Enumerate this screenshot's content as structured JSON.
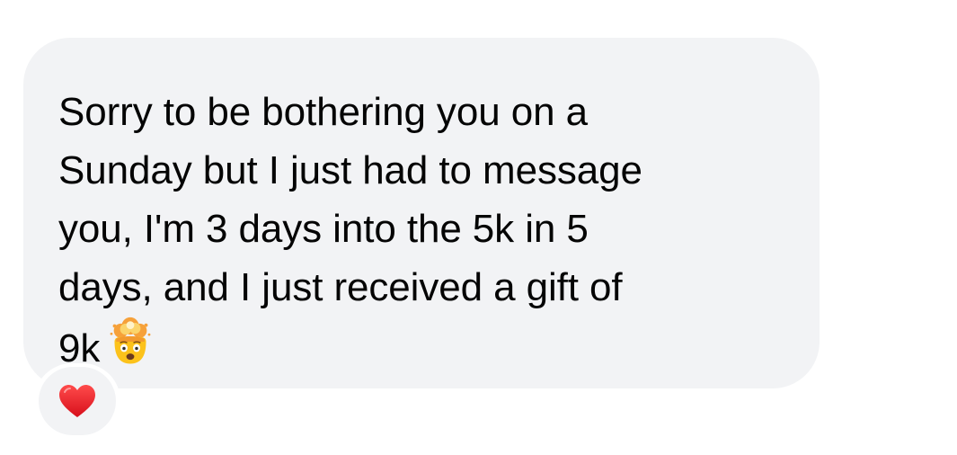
{
  "message": {
    "lines": [
      "Sorry to be bothering you on a",
      "Sunday but I just had to message",
      "you, I'm 3 days into the 5k in 5",
      "days, and I just received a gift of",
      "9k"
    ],
    "trailing_emoji": "exploding-head-icon"
  },
  "reaction": {
    "emoji": "red-heart-icon",
    "color": "#e0171f"
  },
  "colors": {
    "bubble_background": "#f2f3f5",
    "text": "#050505",
    "page_background": "#ffffff"
  }
}
